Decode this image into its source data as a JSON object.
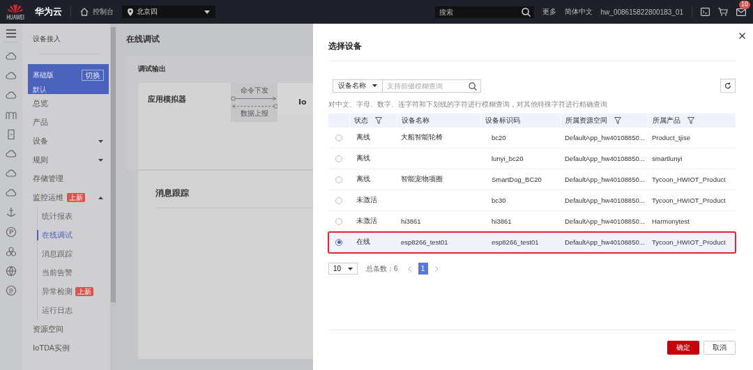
{
  "top_bar": {
    "logo_text": "HUAWEI",
    "brand": "华为云",
    "console": "控制台",
    "region": "北京四",
    "search_placeholder": "搜索",
    "links": [
      "更多",
      "简体中文"
    ],
    "user": "hw_008615822800183_01",
    "mail_badge": "10"
  },
  "sidebar": {
    "title": "设备接入",
    "edition": {
      "name": "基础版",
      "sub": "默认",
      "switch": "切换"
    },
    "items": [
      {
        "label": "总览",
        "kind": "link"
      },
      {
        "label": "产品",
        "kind": "link"
      },
      {
        "label": "设备",
        "kind": "group",
        "expanded": false
      },
      {
        "label": "规则",
        "kind": "group",
        "expanded": false
      },
      {
        "label": "存储管理",
        "kind": "link"
      },
      {
        "label": "监控运维",
        "kind": "group",
        "expanded": true,
        "badge": "上新",
        "children": [
          {
            "label": "统计报表",
            "selected": false
          },
          {
            "label": "在线调试",
            "selected": true
          },
          {
            "label": "消息跟踪",
            "selected": false
          },
          {
            "label": "当前告警",
            "selected": false
          },
          {
            "label": "异常检测",
            "selected": false,
            "badge": "上新"
          },
          {
            "label": "运行日志",
            "selected": false
          }
        ]
      },
      {
        "label": "资源空间",
        "kind": "link"
      },
      {
        "label": "IoTDA实例",
        "kind": "link"
      }
    ]
  },
  "main": {
    "title": "在线调试",
    "output_card": {
      "title": "调试输出",
      "simulator": "应用模拟器",
      "down_label": "命令下发",
      "up_label": "数据上报",
      "device_partial": "Io"
    },
    "trace_card": {
      "title": "消息跟踪"
    }
  },
  "dialog": {
    "title": "选择设备",
    "filter": {
      "field": "设备名称",
      "placeholder": "支持前缀模糊查询"
    },
    "hint": "对中文、字母、数字、连字符和下划线的字符进行模糊查询，对其他特殊字符进行精确查询",
    "table": {
      "columns": [
        {
          "label": "状态",
          "filter": true
        },
        {
          "label": "设备名称",
          "filter": false
        },
        {
          "label": "设备标识码",
          "filter": false
        },
        {
          "label": "所属资源空间",
          "filter": true
        },
        {
          "label": "所属产品",
          "filter": true
        }
      ],
      "rows": [
        {
          "selected": false,
          "annotated": false,
          "cells": [
            "离线",
            "大船智能轮椅",
            "bc20",
            "DefaultApp_hw40108850...",
            "Product_tjise"
          ]
        },
        {
          "selected": false,
          "annotated": false,
          "cells": [
            "离线",
            "",
            "lunyi_bc20",
            "DefaultApp_hw40108850...",
            "smartlunyi"
          ]
        },
        {
          "selected": false,
          "annotated": false,
          "cells": [
            "离线",
            "智能宠物项圈",
            "SmartDog_BC20",
            "DefaultApp_hw40108850...",
            "Tycoon_HWIOT_Product"
          ]
        },
        {
          "selected": false,
          "annotated": false,
          "cells": [
            "未激活",
            "",
            "bc30",
            "DefaultApp_hw40108850...",
            "Tycoon_HWIOT_Product"
          ]
        },
        {
          "selected": false,
          "annotated": false,
          "cells": [
            "未激活",
            "hi3861",
            "hi3861",
            "DefaultApp_hw40108850...",
            "Harmonytest"
          ]
        },
        {
          "selected": true,
          "annotated": true,
          "cells": [
            "在线",
            "esp8266_test01",
            "esp8266_test01",
            "DefaultApp_hw40108850...",
            "Tycoon_HWIOT_Product"
          ]
        }
      ]
    },
    "pagination": {
      "page_size": "10",
      "total": "总条数：6",
      "pages": [
        {
          "label": "1",
          "selected": true
        }
      ]
    },
    "buttons": [
      {
        "label": "确定",
        "kind": "primary"
      },
      {
        "label": "取消",
        "kind": "secondary"
      }
    ]
  }
}
